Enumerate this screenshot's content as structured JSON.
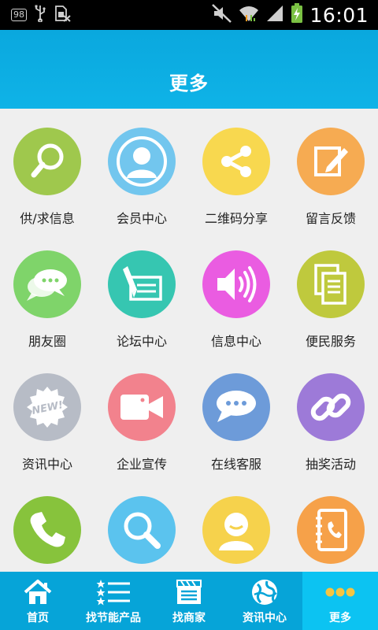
{
  "status_bar": {
    "badge": "98",
    "time": "16:01"
  },
  "header": {
    "title": "更多"
  },
  "grid": {
    "items": [
      {
        "label": "供/求信息",
        "color": "#9fc84d",
        "icon": "magnifier-icon"
      },
      {
        "label": "会员中心",
        "color": "#72c6ee",
        "icon": "member-avatar-icon"
      },
      {
        "label": "二维码分享",
        "color": "#f8d84f",
        "icon": "share-icon"
      },
      {
        "label": "留言反馈",
        "color": "#f6ab52",
        "icon": "edit-note-icon"
      },
      {
        "label": "朋友圈",
        "color": "#7fd46a",
        "icon": "chat-bubbles-icon"
      },
      {
        "label": "论坛中心",
        "color": "#36c6b1",
        "icon": "pen-writing-icon"
      },
      {
        "label": "信息中心",
        "color": "#ea5ce1",
        "icon": "speaker-icon"
      },
      {
        "label": "便民服务",
        "color": "#bfc93d",
        "icon": "documents-icon"
      },
      {
        "label": "资讯中心",
        "color": "#b7bcc6",
        "icon": "new-badge-icon"
      },
      {
        "label": "企业宣传",
        "color": "#f2828d",
        "icon": "video-camera-icon"
      },
      {
        "label": "在线客服",
        "color": "#6d9bd9",
        "icon": "chat-bubble-icon"
      },
      {
        "label": "抽奖活动",
        "color": "#9d7ad8",
        "icon": "link-chain-icon"
      },
      {
        "label": "",
        "color": "#87c33c",
        "icon": "phone-icon"
      },
      {
        "label": "",
        "color": "#5bc3ee",
        "icon": "search-icon"
      },
      {
        "label": "",
        "color": "#f6d24c",
        "icon": "user-icon"
      },
      {
        "label": "",
        "color": "#f6a149",
        "icon": "address-book-icon"
      }
    ]
  },
  "tabbar": {
    "tabs": [
      {
        "label": "首页",
        "icon": "home-icon"
      },
      {
        "label": "找节能产品",
        "icon": "list-icon"
      },
      {
        "label": "找商家",
        "icon": "store-icon"
      },
      {
        "label": "资讯中心",
        "icon": "globe-icon"
      },
      {
        "label": "更多",
        "icon": "more-dots-icon"
      }
    ],
    "active_index": 4
  }
}
